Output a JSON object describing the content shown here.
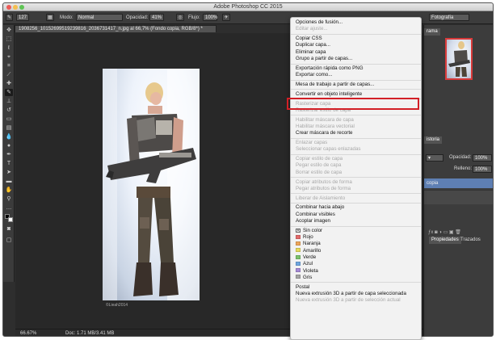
{
  "window": {
    "title": "Adobe Photoshop CC 2015"
  },
  "options_bar": {
    "brush_size": "127",
    "mode_label": "Modo:",
    "mode_value": "Normal",
    "opacity_label": "Opacidad:",
    "opacity_value": "41%",
    "flow_label": "Flujo:",
    "flow_value": "100%",
    "workspace_value": "Fotografía"
  },
  "document": {
    "tab_title": "1908256_10152699519239816_2036731417_n.jpg al 66,7% (Fondo copia, RGB/8*) *",
    "watermark": "©Lieah2014"
  },
  "status_bar": {
    "zoom": "66.67%",
    "doc_info": "Doc: 1.71 MB/3.41 MB"
  },
  "panels": {
    "navigator_tab": "rama",
    "history_tab": "istoria",
    "opacity_label": "Opacidad:",
    "opacity_value": "100%",
    "fill_label": "Relleno:",
    "fill_value": "100%",
    "selected_layer": "copia",
    "bottom_tabs": [
      "Propiedades",
      "Trazados"
    ]
  },
  "context_menu": {
    "highlighted_item": "Convertir en objeto inteligente",
    "groups": [
      [
        {
          "label": "Opciones de fusión...",
          "enabled": true
        },
        {
          "label": "Editar ajuste...",
          "enabled": false
        }
      ],
      [
        {
          "label": "Copiar CSS",
          "enabled": true
        },
        {
          "label": "Duplicar capa...",
          "enabled": true
        },
        {
          "label": "Eliminar capa",
          "enabled": true
        },
        {
          "label": "Grupo a partir de capas...",
          "enabled": true
        }
      ],
      [
        {
          "label": "Exportación rápida como PNG",
          "enabled": true
        },
        {
          "label": "Exportar como...",
          "enabled": true
        }
      ],
      [
        {
          "label": "Mesa de trabajo a partir de capas...",
          "enabled": true
        }
      ],
      [
        {
          "label": "Convertir en objeto inteligente",
          "enabled": true
        }
      ],
      [
        {
          "label": "Rasterizar capa",
          "enabled": false
        },
        {
          "label": "Rasterizar estilo de capa",
          "enabled": false
        }
      ],
      [
        {
          "label": "Habilitar máscara de capa",
          "enabled": false
        },
        {
          "label": "Habilitar máscara vectorial",
          "enabled": false
        },
        {
          "label": "Crear máscara de recorte",
          "enabled": true
        }
      ],
      [
        {
          "label": "Enlazar capas",
          "enabled": false
        },
        {
          "label": "Seleccionar capas enlazadas",
          "enabled": false
        }
      ],
      [
        {
          "label": "Copiar estilo de capa",
          "enabled": false
        },
        {
          "label": "Pegar estilo de capa",
          "enabled": false
        },
        {
          "label": "Borrar estilo de capa",
          "enabled": false
        }
      ],
      [
        {
          "label": "Copiar atributos de forma",
          "enabled": false
        },
        {
          "label": "Pegar atributos de forma",
          "enabled": false
        }
      ],
      [
        {
          "label": "Liberar de Aislamiento",
          "enabled": false
        }
      ],
      [
        {
          "label": "Combinar hacia abajo",
          "enabled": true
        },
        {
          "label": "Combinar visibles",
          "enabled": true
        },
        {
          "label": "Acoplar imagen",
          "enabled": true
        }
      ],
      [
        {
          "label": "Sin color",
          "enabled": true,
          "color": "none"
        },
        {
          "label": "Rojo",
          "enabled": true,
          "color": "#e36a6a"
        },
        {
          "label": "Naranja",
          "enabled": true,
          "color": "#eda55a"
        },
        {
          "label": "Amarillo",
          "enabled": true,
          "color": "#e6da5c"
        },
        {
          "label": "Verde",
          "enabled": true,
          "color": "#7cc26c"
        },
        {
          "label": "Azul",
          "enabled": true,
          "color": "#6fa6e0"
        },
        {
          "label": "Violeta",
          "enabled": true,
          "color": "#a68ad6"
        },
        {
          "label": "Gris",
          "enabled": true,
          "color": "#a5a5a5"
        }
      ],
      [
        {
          "label": "Postal",
          "enabled": true
        },
        {
          "label": "Nueva extrusión 3D a partir de capa seleccionada",
          "enabled": true
        },
        {
          "label": "Nueva extrusión 3D a partir de selección actual",
          "enabled": false
        }
      ]
    ]
  }
}
